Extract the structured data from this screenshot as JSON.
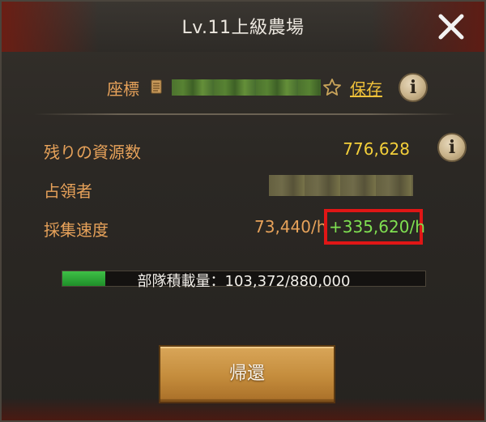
{
  "header": {
    "title": "Lv.11上級農場"
  },
  "coordinates": {
    "label": "座標",
    "save_label": "保存"
  },
  "info": {
    "remaining_resources_label": "残りの資源数",
    "remaining_resources_value": "776,628",
    "occupant_label": "占領者",
    "gather_speed_label": "採集速度",
    "gather_speed_value": "73,440/h",
    "gather_speed_bonus": "+335,620/h"
  },
  "capacity": {
    "text": "部隊積載量：103,372/880,000",
    "fraction": 0.1175
  },
  "actions": {
    "return_label": "帰還"
  },
  "colors": {
    "label_orange": "#e7a25a",
    "value_yellow": "#f3cf3a",
    "bonus_green": "#7fe051",
    "highlight_red": "#e01616",
    "bar_green": "#2fa838"
  },
  "icons": {
    "close": "close-icon",
    "document": "document-icon",
    "star": "star-icon",
    "info": "info-icon"
  }
}
